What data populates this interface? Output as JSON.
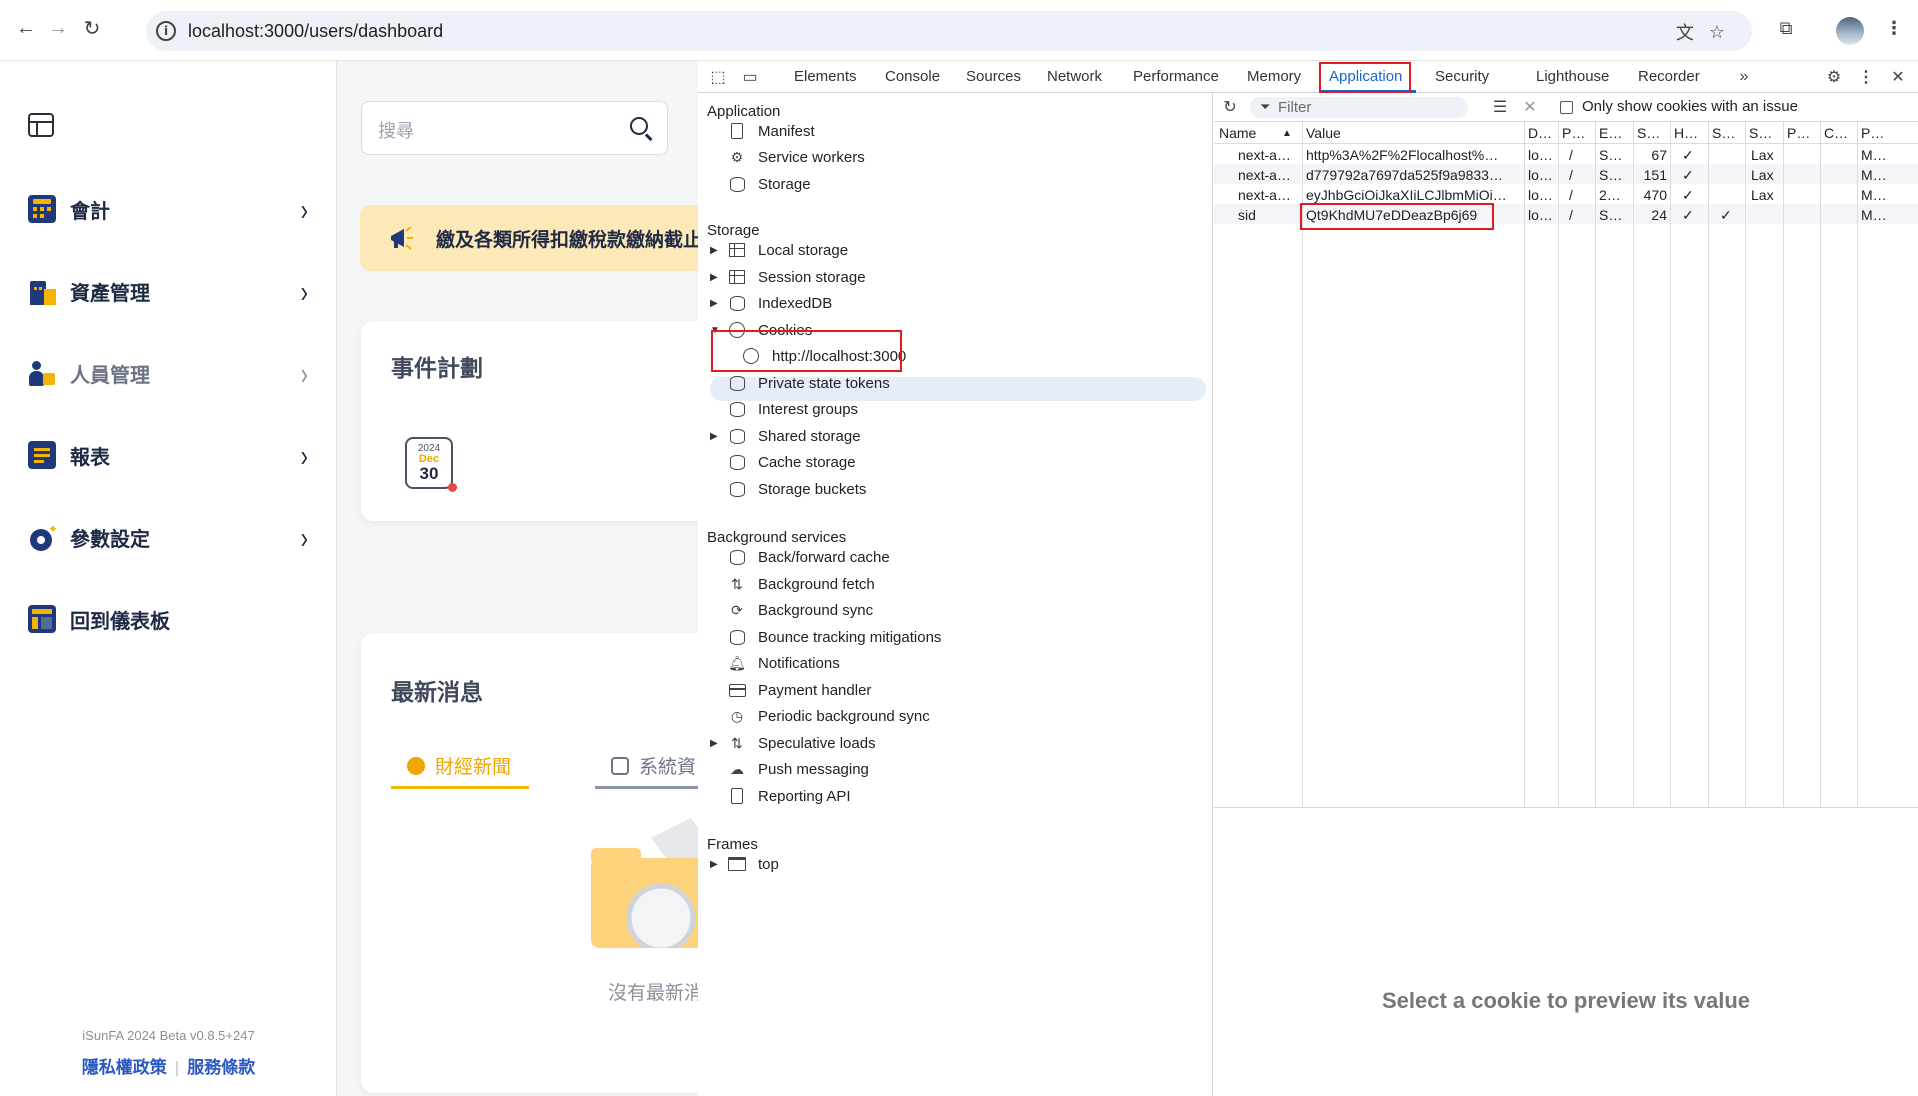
{
  "browser": {
    "url": "localhost:3000/users/dashboard"
  },
  "sidebar": {
    "items": [
      {
        "label": "會計",
        "icon": "calculator-icon"
      },
      {
        "label": "資產管理",
        "icon": "building-icon"
      },
      {
        "label": "人員管理",
        "icon": "person-icon"
      },
      {
        "label": "報表",
        "icon": "report-icon"
      },
      {
        "label": "參數設定",
        "icon": "gear-icon"
      },
      {
        "label": "回到儀表板",
        "icon": "dashboard-icon"
      }
    ],
    "version": "iSunFA 2024 Beta v0.8.5+247",
    "privacy_link": "隱私權政策",
    "terms_link": "服務條款"
  },
  "main": {
    "search_placeholder": "搜尋",
    "announcement": "繳及各類所得扣繳稅款繳納截止",
    "events_title": "事件計劃",
    "calendar": {
      "year": "2024",
      "month": "Dec",
      "day": "30"
    },
    "news_title": "最新消息",
    "news_tabs": [
      "財經新聞",
      "系統資"
    ],
    "empty_text": "沒有最新消"
  },
  "devtools": {
    "tabs": [
      "Elements",
      "Console",
      "Sources",
      "Network",
      "Performance",
      "Memory",
      "Application",
      "Security",
      "Lighthouse",
      "Recorder"
    ],
    "active_tab": "Application",
    "sections": {
      "application": {
        "heading": "Application",
        "items": [
          "Manifest",
          "Service workers",
          "Storage"
        ]
      },
      "storage": {
        "heading": "Storage",
        "items": [
          "Local storage",
          "Session storage",
          "IndexedDB",
          "Cookies",
          "http://localhost:3000",
          "Private state tokens",
          "Interest groups",
          "Shared storage",
          "Cache storage",
          "Storage buckets"
        ]
      },
      "background": {
        "heading": "Background services",
        "items": [
          "Back/forward cache",
          "Background fetch",
          "Background sync",
          "Bounce tracking mitigations",
          "Notifications",
          "Payment handler",
          "Periodic background sync",
          "Speculative loads",
          "Push messaging",
          "Reporting API"
        ]
      },
      "frames": {
        "heading": "Frames",
        "items": [
          "top"
        ]
      }
    },
    "cookies": {
      "filter_placeholder": "Filter",
      "only_issue_label": "Only show cookies with an issue",
      "columns": [
        "Name",
        "Value",
        "D…",
        "P…",
        "E…",
        "S…",
        "H…",
        "S…",
        "S…",
        "P…",
        "C…",
        "P…"
      ],
      "rows": [
        [
          "next-a…",
          "http%3A%2F%2Flocalhost%…",
          "lo…",
          "/",
          "S…",
          "67",
          "✓",
          "",
          "Lax",
          "",
          "",
          "M…"
        ],
        [
          "next-a…",
          "d779792a7697da525f9a9833…",
          "lo…",
          "/",
          "S…",
          "151",
          "✓",
          "",
          "Lax",
          "",
          "",
          "M…"
        ],
        [
          "next-a…",
          "eyJhbGciOiJkaXIiLCJlbmMiOi…",
          "lo…",
          "/",
          "2…",
          "470",
          "✓",
          "",
          "Lax",
          "",
          "",
          "M…"
        ],
        [
          "sid",
          "Qt9KhdMU7eDDeazBp6j69",
          "lo…",
          "/",
          "S…",
          "24",
          "✓",
          "✓",
          "",
          "",
          "",
          "M…"
        ]
      ],
      "preview_message": "Select a cookie to preview its value"
    }
  }
}
